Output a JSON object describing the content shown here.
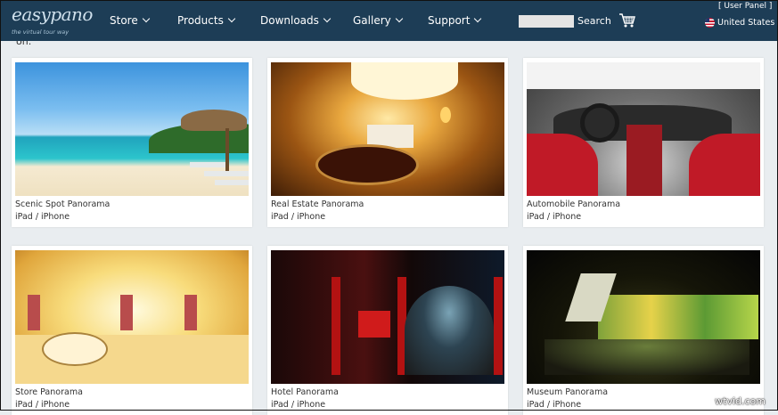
{
  "header": {
    "logo_text": "easypano",
    "logo_tagline": "the virtual tour way",
    "nav": [
      "Store",
      "Products",
      "Downloads",
      "Gallery",
      "Support"
    ],
    "search_button": "Search",
    "search_placeholder": "",
    "user_panel": "[ User Panel ]",
    "region": "United States"
  },
  "partial_text": "on.",
  "cards": [
    {
      "title": "Scenic Spot Panorama",
      "subtitle": "iPad / iPhone"
    },
    {
      "title": "Real Estate Panorama",
      "subtitle": "iPad / iPhone"
    },
    {
      "title": "Automobile Panorama",
      "subtitle": "iPad / iPhone"
    },
    {
      "title": "Store Panorama",
      "subtitle": "iPad / iPhone"
    },
    {
      "title": "Hotel Panorama",
      "subtitle": "iPad / iPhone"
    },
    {
      "title": "Museum Panorama",
      "subtitle": "iPad / iPhone"
    }
  ],
  "watermark": "wtvid.com",
  "colors": {
    "header_bg": "#1d3d56",
    "page_bg": "#e9edf0",
    "card_bg": "#ffffff"
  }
}
